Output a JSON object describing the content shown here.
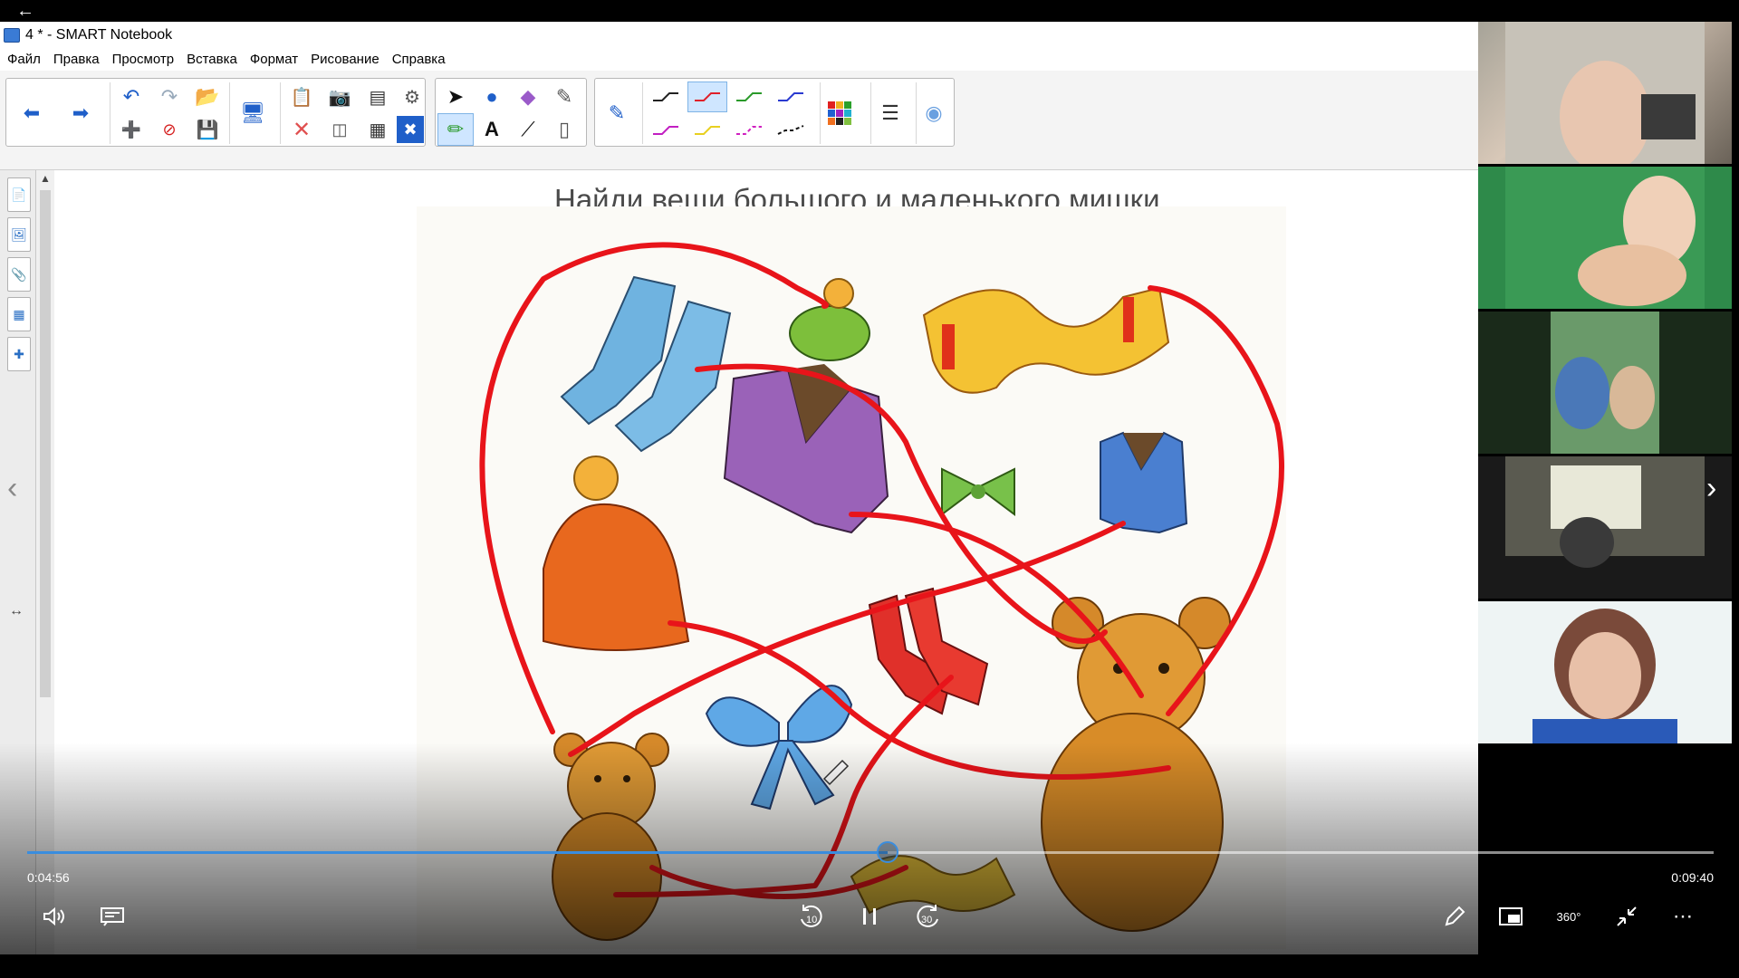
{
  "window": {
    "title": "4 * - SMART Notebook"
  },
  "menu": {
    "items": [
      "Файл",
      "Правка",
      "Просмотр",
      "Вставка",
      "Формат",
      "Рисование",
      "Справка"
    ]
  },
  "toolbar": {
    "icons": {
      "back": "arrow-left-icon",
      "forward": "arrow-right-icon",
      "undo": "undo-icon",
      "redo": "redo-icon",
      "open": "folder-open-icon",
      "add_page": "add-page-icon",
      "delete_page": "delete-page-icon",
      "save": "save-icon",
      "display": "display-icon",
      "paste": "paste-icon",
      "delete": "delete-icon",
      "screenshade": "screen-shade-icon",
      "capture": "camera-icon",
      "table": "table-icon",
      "fullscreen": "fullscreen-icon",
      "extras": "extras-icon",
      "select": "cursor-icon",
      "shapes": "shapes-icon",
      "eraser": "eraser-icon",
      "magic_pen": "magic-pen-icon",
      "pens": "pens-icon",
      "text": "text-icon",
      "line": "line-icon",
      "fill": "fill-icon",
      "pen_tool": "pen-icon",
      "colors": "color-palette-icon",
      "line_style": "line-style-icon",
      "properties": "properties-icon"
    },
    "pen_colors": [
      "#222222",
      "#e0202a",
      "#2a9a2a",
      "#2a3ad0",
      "#c21fc2",
      "#e8d020",
      "#d020c0",
      "#111111"
    ]
  },
  "sidebar": {
    "icons": [
      "page-sorter-icon",
      "gallery-icon",
      "attachments-icon",
      "properties-icon",
      "addons-icon"
    ]
  },
  "page": {
    "title": "Найди вещи большого и маленького мишки."
  },
  "video": {
    "current_time": "0:04:56",
    "total_time": "0:09:40",
    "progress": 0.51,
    "accent": "#3a8dde",
    "controls": {
      "volume": "volume-icon",
      "captions": "captions-icon",
      "rewind": "rewind-10-icon",
      "pause": "pause-icon",
      "forward": "forward-30-icon",
      "pen": "pen-icon",
      "miniplayer": "miniplayer-icon",
      "view360": "360-icon",
      "exit_fullscreen": "exit-fullscreen-icon",
      "more": "more-icon"
    },
    "rewind_label": "10",
    "forward_label": "30",
    "view360_label": "360°"
  },
  "participants": {
    "count": 5
  },
  "colors": {
    "stroke": "#e8141a"
  }
}
